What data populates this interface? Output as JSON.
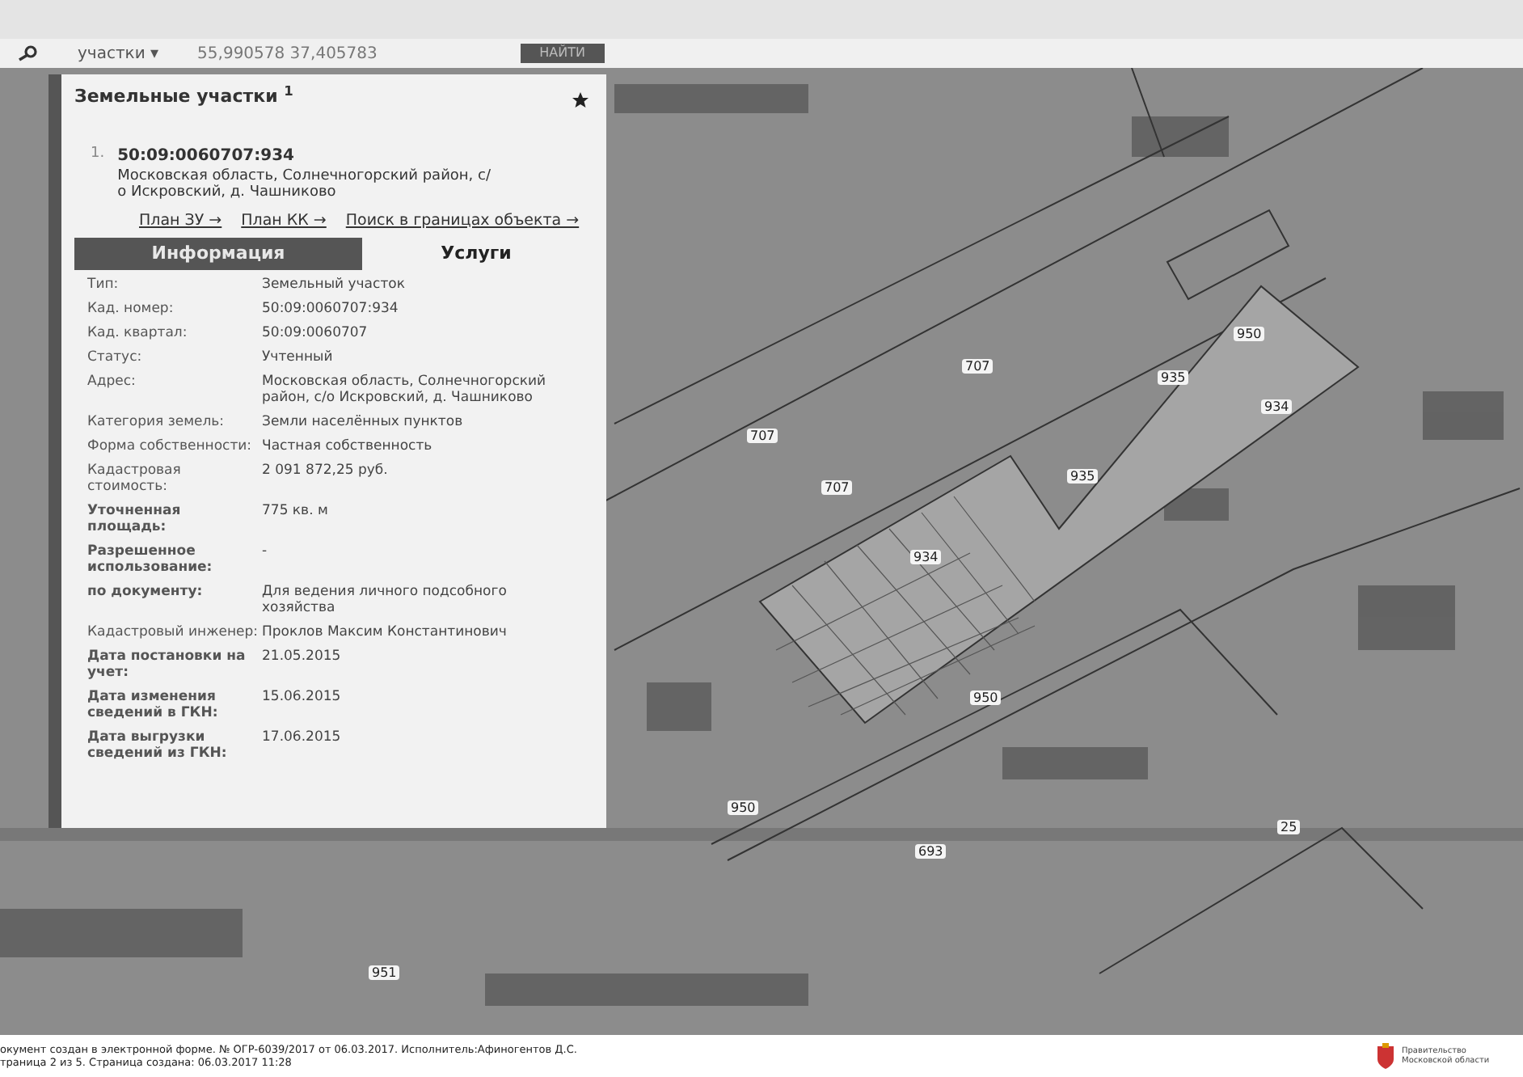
{
  "search_bar": {
    "layer_dropdown": "участки",
    "dropdown_caret": "▾",
    "coordinates": "55,990578 37,405783",
    "button": "НАЙТИ"
  },
  "panel": {
    "title": "Земельные участки",
    "title_sup": "1",
    "result": {
      "number": "1.",
      "cadastral_number": "50:09:0060707:934",
      "address": "Московская область, Солнечногорский район, с/о Искровский, д. Чашниково",
      "links": [
        "План ЗУ →",
        "План КК →",
        "Поиск в границах объекта →"
      ]
    },
    "tabs": [
      {
        "label": "Информация",
        "selected": true
      },
      {
        "label": "Услуги",
        "selected": false
      }
    ],
    "rows": [
      {
        "label": "Тип:",
        "value": "Земельный участок",
        "bold": false
      },
      {
        "label": "Кад. номер:",
        "value": "50:09:0060707:934",
        "bold": false
      },
      {
        "label": "Кад. квартал:",
        "value": "50:09:0060707",
        "bold": false
      },
      {
        "label": "Статус:",
        "value": "Учтенный",
        "bold": false
      },
      {
        "label": "Адрес:",
        "value": "Московская область, Солнечногорский район, с/о Искровский, д. Чашниково",
        "bold": false
      },
      {
        "label": "Категория земель:",
        "value": "Земли населённых пунктов",
        "bold": false
      },
      {
        "label": "Форма собственности:",
        "value": "Частная собственность",
        "bold": false
      },
      {
        "label": "Кадастровая стоимость:",
        "value": "2 091 872,25 руб.",
        "bold": false
      },
      {
        "label": "Уточненная площадь:",
        "value": "775 кв. м",
        "bold": true
      },
      {
        "label": "Разрешенное использование:",
        "value": "-",
        "bold": true
      },
      {
        "label": "по документу:",
        "value": "Для ведения личного подсобного хозяйства",
        "bold": true
      },
      {
        "label": "Кадастровый инженер:",
        "value": "Проклов Максим Константинович",
        "bold": false
      },
      {
        "label": "Дата постановки на учет:",
        "value": "21.05.2015",
        "bold": true
      },
      {
        "label": "Дата изменения сведений в ГКН:",
        "value": "15.06.2015",
        "bold": true
      },
      {
        "label": "Дата выгрузки сведений из ГКН:",
        "value": "17.06.2015",
        "bold": true
      }
    ]
  },
  "map_labels": [
    "707",
    "707",
    "707",
    "935",
    "950",
    "934",
    "935",
    "934",
    "950",
    "950",
    "693",
    "25",
    "951"
  ],
  "footer": {
    "lines": [
      "окумент создан в электронной форме. № ОГР-6039/2017 от 06.03.2017. Исполнитель:Афиногентов Д.С.",
      "траница 2 из 5. Страница создана: 06.03.2017 11:28"
    ],
    "logo_text": "Правительство Московской области"
  }
}
